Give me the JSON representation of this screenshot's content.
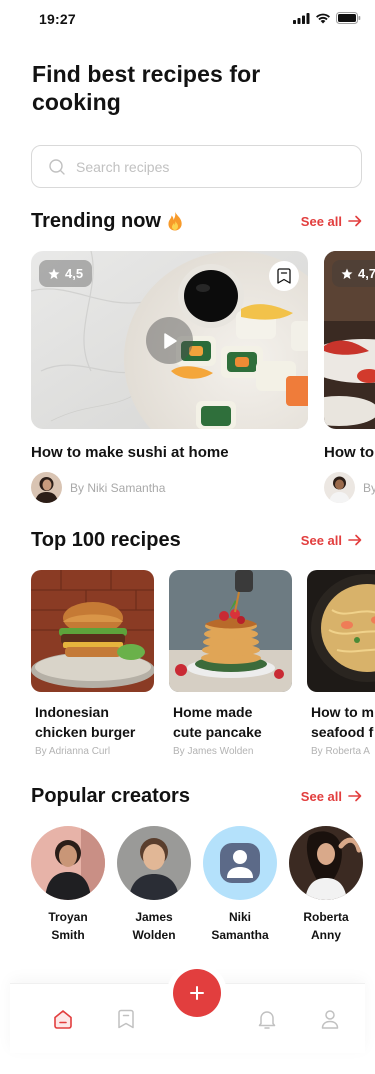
{
  "status": {
    "time": "19:27"
  },
  "header": {
    "title": "Find best recipes for cooking"
  },
  "search": {
    "placeholder": "Search recipes"
  },
  "colors": {
    "accent": "#e23e3e",
    "muted": "#a9a9a9"
  },
  "trending": {
    "title": "Trending now",
    "title_icon": "fire-icon",
    "see_all": "See all",
    "items": [
      {
        "rating": "4,5",
        "title": "How to make sushi at home",
        "author": "By Niki Samantha"
      },
      {
        "rating": "4,7",
        "title": "How to",
        "author": "By"
      }
    ]
  },
  "top_recipes": {
    "title": "Top 100 recipes",
    "see_all": "See all",
    "items": [
      {
        "title_line1": "Indonesian",
        "title_line2": "chicken burger",
        "author": "By Adrianna Curl"
      },
      {
        "title_line1": "Home made",
        "title_line2": "cute pancake",
        "author": "By James Wolden"
      },
      {
        "title_line1": "How to m",
        "title_line2": "seafood f",
        "author": "By Roberta A"
      }
    ]
  },
  "creators": {
    "title": "Popular creators",
    "see_all": "See all",
    "items": [
      {
        "first": "Troyan",
        "last": "Smith"
      },
      {
        "first": "James",
        "last": "Wolden"
      },
      {
        "first": "Niki",
        "last": "Samantha"
      },
      {
        "first": "Roberta",
        "last": "Anny"
      }
    ]
  },
  "nav": {
    "items": [
      "home-icon",
      "bookmark-icon",
      "add-icon",
      "bell-icon",
      "profile-icon"
    ],
    "active": "home-icon"
  }
}
